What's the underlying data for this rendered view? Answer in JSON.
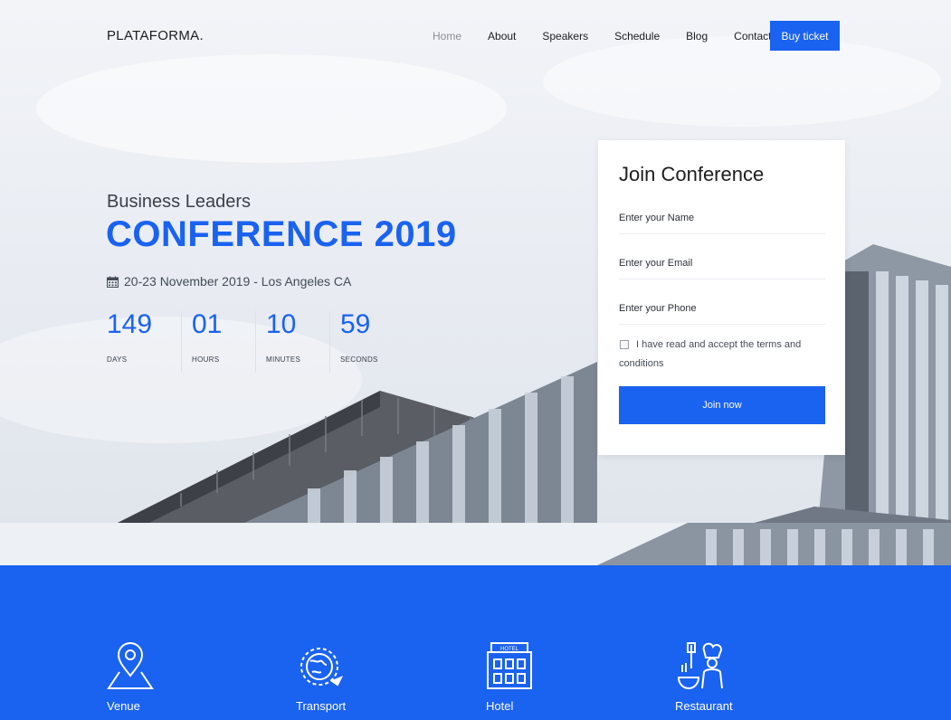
{
  "brand": "PLATAFORMA.",
  "nav": {
    "items": [
      {
        "label": "Home",
        "active": true
      },
      {
        "label": "About",
        "active": false
      },
      {
        "label": "Speakers",
        "active": false
      },
      {
        "label": "Schedule",
        "active": false
      },
      {
        "label": "Blog",
        "active": false
      },
      {
        "label": "Contact",
        "active": false
      }
    ],
    "cta_label": "Buy ticket"
  },
  "hero": {
    "subtitle": "Business Leaders",
    "title": "CONFERENCE 2019",
    "date_location": "20-23 November 2019 - Los Angeles CA",
    "date_icon": "calendar-icon",
    "countdown": [
      {
        "value": "149",
        "label": "DAYS"
      },
      {
        "value": "01",
        "label": "HOURS"
      },
      {
        "value": "10",
        "label": "MINUTES"
      },
      {
        "value": "59",
        "label": "SECONDS"
      }
    ]
  },
  "form": {
    "title": "Join Conference",
    "name_placeholder": "Enter your Name",
    "email_placeholder": "Enter your Email",
    "phone_placeholder": "Enter your Phone",
    "terms_text": "I have read and accept the terms and conditions",
    "submit_label": "Join now"
  },
  "features": [
    {
      "label": "Venue",
      "icon": "map-pin-icon"
    },
    {
      "label": "Transport",
      "icon": "globe-plane-icon"
    },
    {
      "label": "Hotel",
      "icon": "hotel-icon"
    },
    {
      "label": "Restaurant",
      "icon": "chef-icon"
    }
  ],
  "colors": {
    "accent": "#1a62f0",
    "text_dark": "#1d1d1f",
    "nav_active": "#8a8f99"
  }
}
